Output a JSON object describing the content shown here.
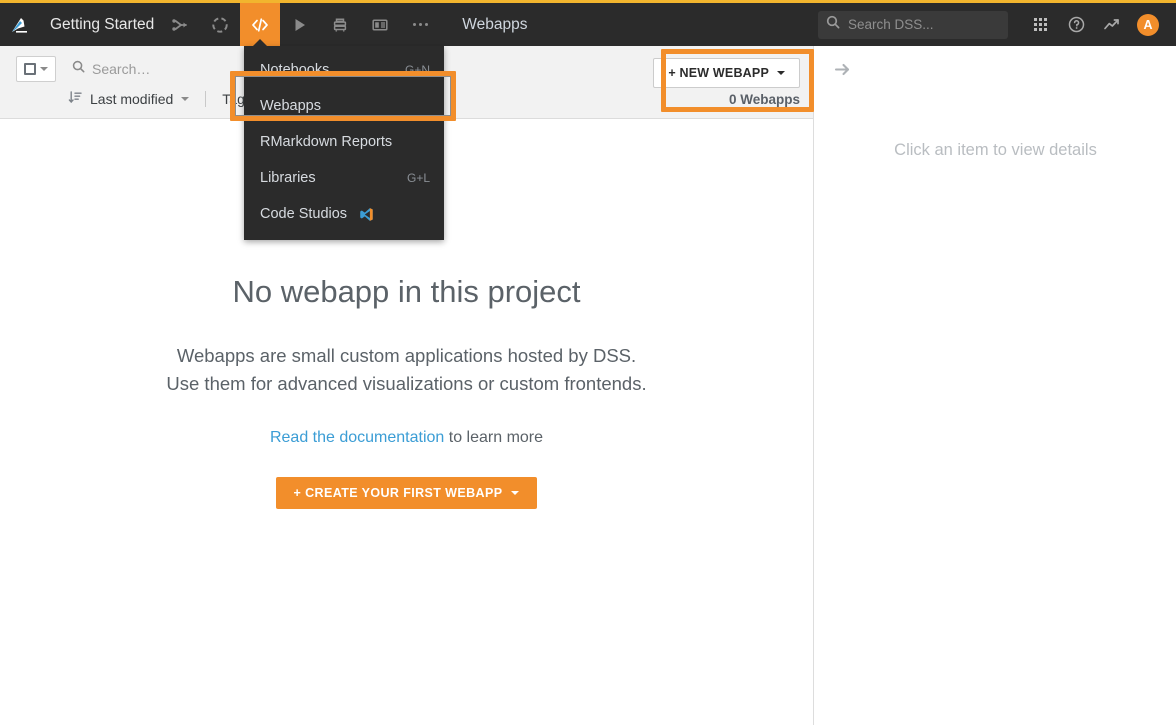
{
  "topbar": {
    "logo_icon": "dataiku-bird-logo",
    "project_title": "Getting Started",
    "nav_icons": [
      {
        "name": "flow-icon",
        "label": "Flow"
      },
      {
        "name": "lab-icon",
        "label": "Lab"
      },
      {
        "name": "code-icon",
        "label": "Code",
        "active": true
      },
      {
        "name": "play-icon",
        "label": "Jobs"
      },
      {
        "name": "layers-icon",
        "label": "Deployments"
      },
      {
        "name": "dashboard-icon",
        "label": "Dashboards"
      },
      {
        "name": "more-icon",
        "label": "More"
      }
    ],
    "section_title": "Webapps",
    "search": {
      "placeholder": "Search DSS...",
      "value": "",
      "icon": "search-icon"
    },
    "apps_icon": "apps-grid-icon",
    "help_icon": "help-circle-icon",
    "activity_icon": "trend-up-icon",
    "avatar_initial": "A",
    "accent_color": "#f28e2b",
    "top_accent_color": "#f2b52e",
    "bar_color": "#2b2b2b"
  },
  "code_menu": {
    "items": [
      {
        "label": "Notebooks",
        "shortcut": "G+N",
        "icon": ""
      },
      {
        "label": "Webapps",
        "shortcut": "",
        "icon": ""
      },
      {
        "label": "RMarkdown Reports",
        "shortcut": "",
        "icon": ""
      },
      {
        "label": "Libraries",
        "shortcut": "G+L",
        "icon": ""
      },
      {
        "label": "Code Studios",
        "shortcut": "",
        "icon": "vscode-icon"
      }
    ]
  },
  "toolbar": {
    "select_all_checkbox": "select-all",
    "search_placeholder": "Search…",
    "search_value": "",
    "sort_icon": "sort-icon",
    "sort_label": "Last modified",
    "tags_label": "Tags",
    "new_button_label": "+ NEW WEBAPP",
    "count_label": "0 Webapps"
  },
  "empty_state": {
    "title": "No webapp in this project",
    "description_line1": "Webapps are small custom applications hosted by DSS.",
    "description_line2": "Use them for advanced visualizations or custom frontends.",
    "doc_link_text": "Read the documentation",
    "doc_suffix_text": " to learn more",
    "cta_label": "+ CREATE YOUR FIRST WEBAPP"
  },
  "right_panel": {
    "collapse_icon": "arrow-right-icon",
    "hint": "Click an item to view details"
  },
  "annotations": {
    "highlight_color": "#f28e2b",
    "boxes": [
      {
        "name": "webapps-menu-item-highlight"
      },
      {
        "name": "new-webapp-button-highlight"
      }
    ]
  }
}
